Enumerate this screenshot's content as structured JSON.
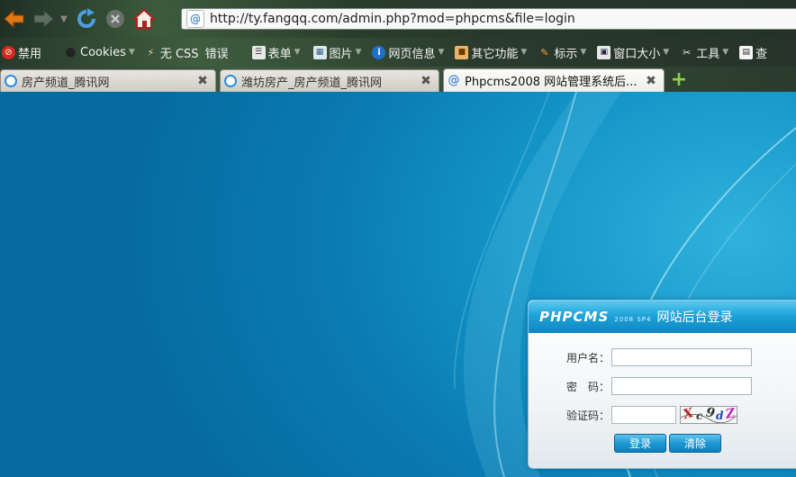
{
  "browser": {
    "url": "http://ty.fangqq.com/admin.php?mod=phpcms&file=login",
    "toolbar_items": [
      {
        "label": "禁用",
        "icon": "block-icon"
      },
      {
        "label": "Cookies",
        "icon": "person-icon"
      },
      {
        "label": "无 CSS",
        "icon": "wand-icon"
      },
      {
        "label": "错误",
        "icon": ""
      },
      {
        "label": "表单",
        "icon": "form-icon"
      },
      {
        "label": "图片",
        "icon": "image-icon"
      },
      {
        "label": "网页信息",
        "icon": "info-icon"
      },
      {
        "label": "其它功能",
        "icon": "box-icon"
      },
      {
        "label": "标示",
        "icon": "pencil-icon"
      },
      {
        "label": "窗口大小",
        "icon": "window-icon"
      },
      {
        "label": "工具",
        "icon": "tools-icon"
      },
      {
        "label": "查",
        "icon": "page-icon"
      }
    ],
    "tabs": [
      {
        "title": "房产频道_腾讯网",
        "active": false
      },
      {
        "title": "潍坊房产_房产频道_腾讯网",
        "active": false
      },
      {
        "title": "Phpcms2008 网站管理系统后...",
        "active": true
      }
    ],
    "site_icon_glyph": "@"
  },
  "login": {
    "logo": "PHPCMS",
    "version": "2008 SP4",
    "title": "网站后台登录",
    "username_label": "用户名：",
    "password_label": "密　码：",
    "captcha_label": "验证码：",
    "captcha_chars": [
      "X",
      "c",
      "9",
      "d",
      "Z"
    ],
    "login_button": "登录",
    "clear_button": "清除"
  },
  "colors": {
    "page_background": "#0a7db3",
    "panel_header": "#1ea3d9",
    "button": "#1e98d2"
  }
}
